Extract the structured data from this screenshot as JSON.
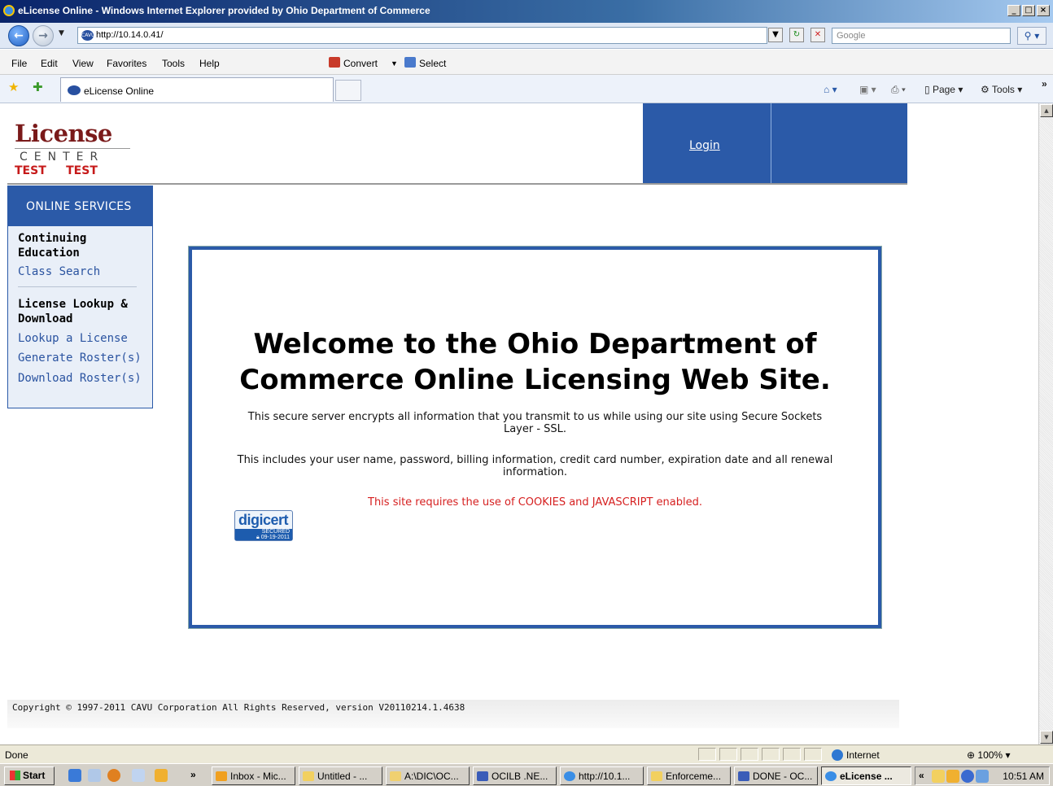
{
  "window": {
    "title": "eLicense Online - Windows Internet Explorer provided by Ohio Department of Commerce",
    "controls": [
      "_",
      "□",
      "×"
    ]
  },
  "browser": {
    "url": "http://10.14.0.41/",
    "search_placeholder": "Google",
    "menu": [
      "File",
      "Edit",
      "View",
      "Favorites",
      "Tools",
      "Help"
    ],
    "toolbar_convert": "Convert",
    "toolbar_select": "Select",
    "tab_title": "eLicense Online",
    "cmd_page": "Page",
    "cmd_tools": "Tools",
    "chevron": "»"
  },
  "header": {
    "logo_word": "License",
    "logo_center": "CENTER",
    "logo_test": "TEST     TEST",
    "login_label": "Login"
  },
  "sidebar": {
    "heading": "ONLINE SERVICES",
    "sections": [
      {
        "title": "Continuing Education",
        "links": [
          "Class Search"
        ]
      },
      {
        "title": "License Lookup & Download",
        "links": [
          "Lookup a License",
          "Generate Roster(s)",
          "Download Roster(s)"
        ]
      }
    ]
  },
  "welcome": {
    "heading": "Welcome to the Ohio Department of Commerce Online Licensing Web Site.",
    "para1": "This secure server encrypts all information that you transmit to us while using our site using Secure Sockets Layer - SSL.",
    "para2": "This includes your user name, password, billing information, credit card number, expiration date and all renewal information.",
    "cookie_note": "This site requires the use of COOKIES and JAVASCRIPT enabled.",
    "seal_brand": "digicert",
    "seal_line": "SECURED",
    "seal_date": "09-19-2011"
  },
  "footer": {
    "copyright": "Copyright © 1997-2011 CAVU Corporation All Rights Reserved, version V20110214.1.4638"
  },
  "statusbar": {
    "status": "Done",
    "zone": "Internet",
    "zoom": "100%"
  },
  "taskbar": {
    "start": "Start",
    "chevron": "»",
    "tasks": [
      "Inbox - Mic...",
      "Untitled - ...",
      "A:\\DIC\\OC...",
      "OCILB .NE...",
      "http://10.1...",
      "Enforceme...",
      "DONE - OC...",
      "eLicense ..."
    ],
    "tray_chevron": "«",
    "clock": "10:51 AM"
  },
  "colors": {
    "brand_blue": "#2b5aa8",
    "link_blue": "#2a53a0",
    "warning_red": "#d62020",
    "logo_red": "#c61a1a"
  }
}
